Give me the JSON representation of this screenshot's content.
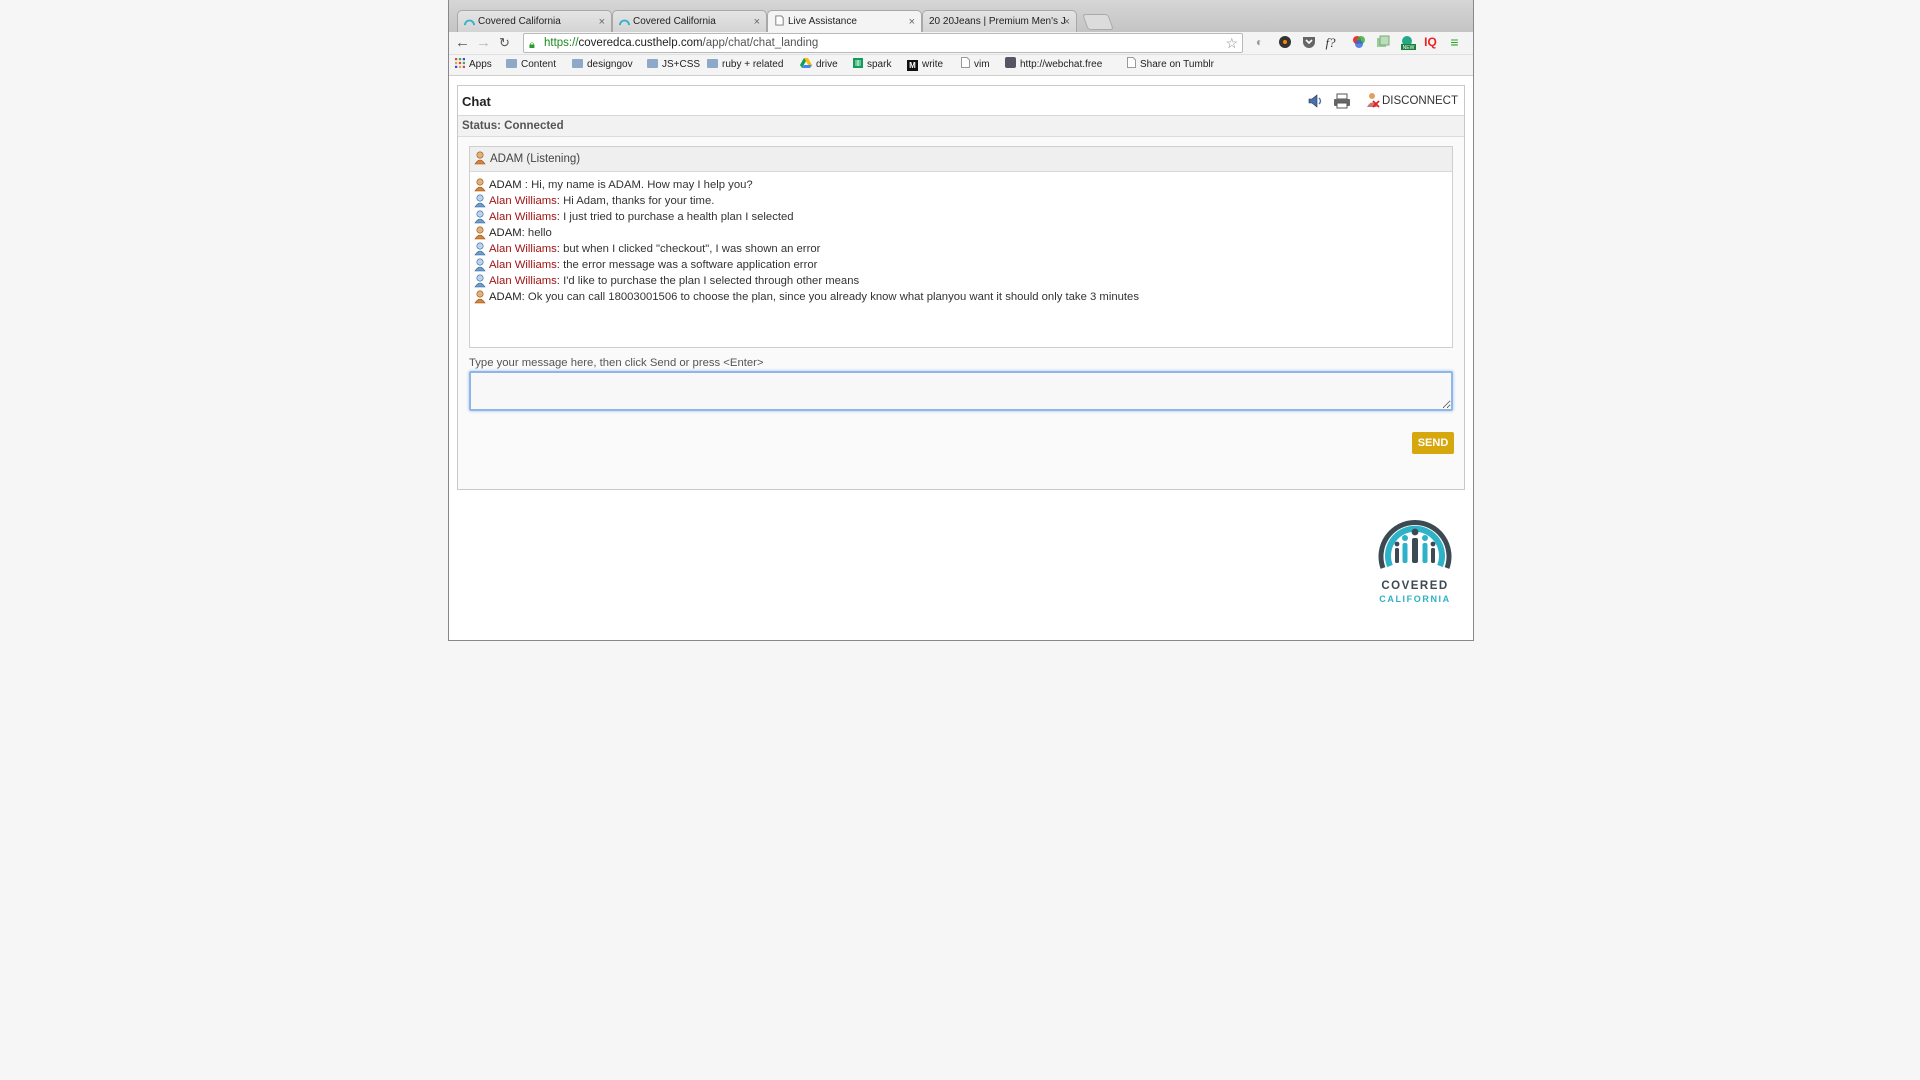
{
  "browser": {
    "tabs": [
      {
        "label": "Covered California",
        "active": false
      },
      {
        "label": "Covered California",
        "active": false
      },
      {
        "label": "Live Assistance",
        "active": true
      },
      {
        "label": "20 20Jeans | Premium Men's J",
        "active": false
      }
    ],
    "address": {
      "scheme": "https://",
      "host": "coveredca.custhelp.com",
      "path": "/app/chat/chat_landing"
    },
    "bookmarks": [
      {
        "label": "Apps",
        "icon": "apps-grid-icon"
      },
      {
        "label": "Content",
        "icon": "folder-icon"
      },
      {
        "label": "designgov",
        "icon": "folder-icon"
      },
      {
        "label": "JS+CSS",
        "icon": "folder-icon"
      },
      {
        "label": "ruby + related",
        "icon": "folder-icon"
      },
      {
        "label": "drive",
        "icon": "drive-icon"
      },
      {
        "label": "spark",
        "icon": "spreadsheet-icon"
      },
      {
        "label": "write",
        "icon": "m-icon"
      },
      {
        "label": "vim",
        "icon": "page-icon"
      },
      {
        "label": "http://webchat.free",
        "icon": "webchat-icon"
      },
      {
        "label": "Share on Tumblr",
        "icon": "page-icon"
      }
    ],
    "extension_new_badge": "NEW",
    "extension_iq": "IQ",
    "extension_f": "f?"
  },
  "chat": {
    "title": "Chat",
    "status": "Status: Connected",
    "disconnect_label": "DISCONNECT",
    "agent_header": "ADAM  (Listening)",
    "messages": [
      {
        "sender": "ADAM",
        "sep": " : ",
        "text": "Hi, my name is ADAM. How may I help you?",
        "role": "agent"
      },
      {
        "sender": "Alan Williams",
        "sep": ": ",
        "text": "Hi Adam, thanks for your time.",
        "role": "user"
      },
      {
        "sender": "Alan Williams",
        "sep": ": ",
        "text": "I just tried to purchase a health plan I selected",
        "role": "user"
      },
      {
        "sender": "ADAM",
        "sep": ": ",
        "text": "hello",
        "role": "agent"
      },
      {
        "sender": "Alan Williams",
        "sep": ": ",
        "text": "but when I clicked \"checkout\", I was shown an error",
        "role": "user"
      },
      {
        "sender": "Alan Williams",
        "sep": ": ",
        "text": "the error message was a software application error",
        "role": "user"
      },
      {
        "sender": "Alan Williams",
        "sep": ": ",
        "text": "I'd like to purchase the plan I selected through other means",
        "role": "user"
      },
      {
        "sender": "ADAM",
        "sep": ": ",
        "text": "Ok you can call 18003001506 to choose the plan, since you already know what planyou want it should only take 3 minutes",
        "role": "agent"
      }
    ],
    "input_label": "Type your message here, then click Send or press <Enter>",
    "input_value": "",
    "send_label": "SEND"
  },
  "logo": {
    "line1": "COVERED",
    "line2": "CALIFORNIA"
  },
  "colors": {
    "send": "#d7a70e",
    "user_name": "#a01414",
    "logo_teal": "#2db2c7",
    "logo_dark": "#3b4a53"
  }
}
